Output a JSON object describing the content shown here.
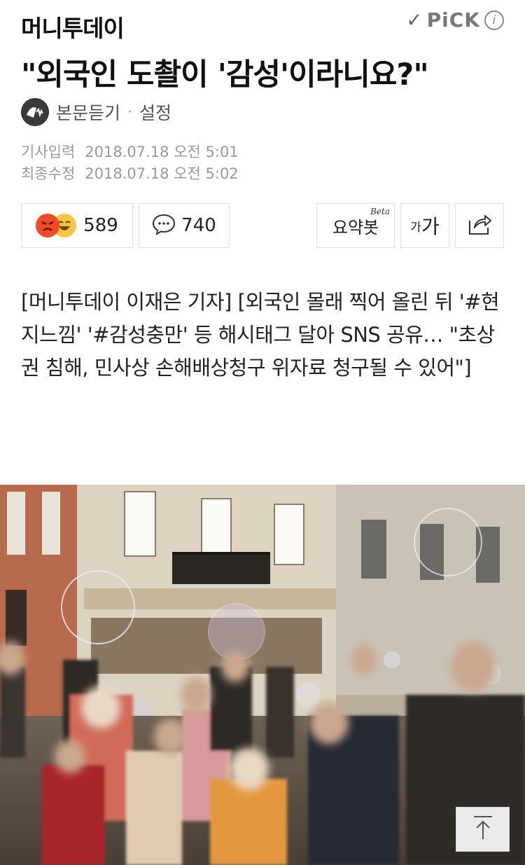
{
  "header": {
    "press_name": "머니투데이",
    "pick_label": "PiCK",
    "info_glyph": "i"
  },
  "article": {
    "title": "\"외국인 도촬이 '감성'이라니요?\"",
    "tts_label": "본문듣기",
    "settings_label": "설정",
    "input_label": "기사입력",
    "input_date": "2018.07.18 오전 5:01",
    "modified_label": "최종수정",
    "modified_date": "2018.07.18 오전 5:02",
    "body": "[머니투데이 이재은 기자] [외국인 몰래 찍어 올린 뒤 '#현지느낌' '#감성충만' 등 해시태그 달아 SNS 공유… \"초상권 침해, 민사상 손해배상청구 위자료 청구될 수 있어\"]"
  },
  "actions": {
    "reaction_count": "589",
    "comment_count": "740",
    "summary_label": "요약봇",
    "summary_badge": "Beta",
    "font_small": "가",
    "font_large": "가"
  },
  "icons": {
    "tts": "headphone-speaker-icon",
    "check": "check-icon",
    "info": "info-icon",
    "angry": "angry-face-icon",
    "laugh": "laugh-face-icon",
    "comment": "speech-bubble-icon",
    "share": "share-icon",
    "top": "arrow-up-icon"
  },
  "colors": {
    "angry": "#f04a2b",
    "laugh": "#f6c544",
    "secondary_text": "#999999"
  }
}
